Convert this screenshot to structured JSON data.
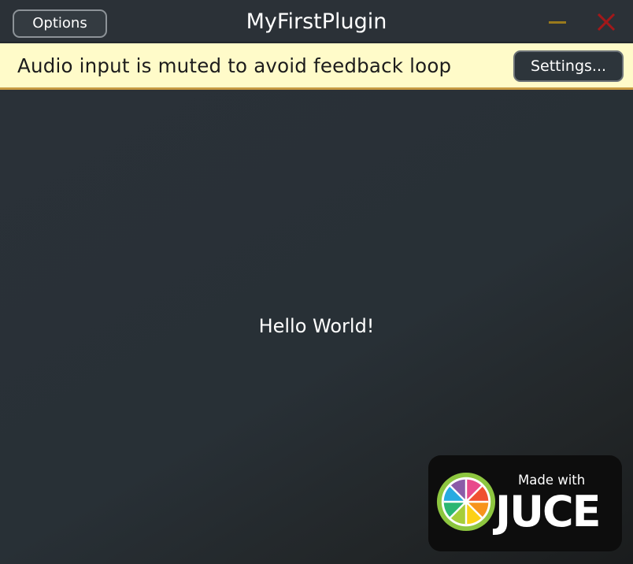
{
  "window": {
    "title": "MyFirstPlugin"
  },
  "titlebar": {
    "options_label": "Options",
    "minimize_icon": "minimize-icon",
    "close_icon": "close-icon"
  },
  "banner": {
    "message": "Audio input is muted to avoid feedback loop",
    "settings_label": "Settings..."
  },
  "content": {
    "text": "Hello World!"
  },
  "badge": {
    "made_with": "Made with",
    "brand": "JUCE",
    "logo_icon": "juce-logo-icon"
  },
  "colors": {
    "background": "#2a3036",
    "banner_bg": "#fffbc9",
    "banner_border": "#c79a43",
    "minimize": "#9a7a1c",
    "close": "#a3181a"
  }
}
